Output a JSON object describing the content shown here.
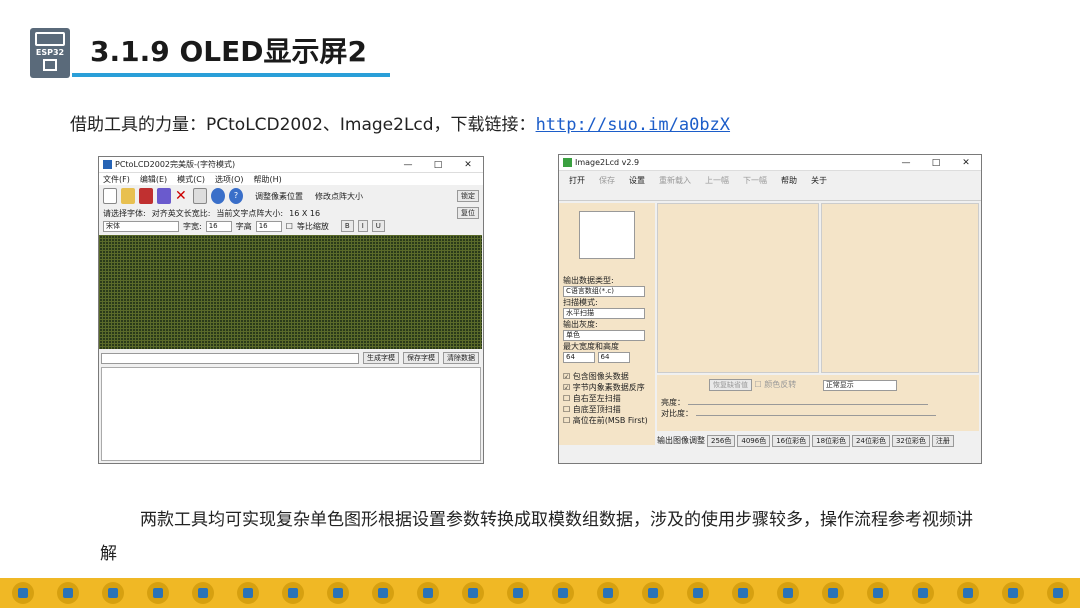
{
  "header": {
    "title": "3.1.9 OLED显示屏2",
    "logo_label": "ESP32"
  },
  "intro": {
    "text": "借助工具的力量：PCtoLCD2002、Image2Lcd，下载链接：",
    "link": "http://suo.im/a0bzX"
  },
  "pctolcd": {
    "title": "PCtoLCD2002完美版-(字符模式)",
    "menu": [
      "文件(F)",
      "编辑(E)",
      "模式(C)",
      "选项(O)",
      "帮助(H)"
    ],
    "labels": {
      "adjust": "调整像素位置",
      "modify": "修改点阵大小",
      "size_hint": "当前文字点阵大小:",
      "size_val": "16 X 16",
      "lock": "锁定",
      "reset": "复位",
      "choose_font": "请选择字体:",
      "align": "对齐英文长宽比:",
      "font_val": "宋体",
      "width_lbl": "字宽:",
      "width_val": "16",
      "height_lbl": "字高",
      "height_val": "16",
      "scale": "等比缩放"
    },
    "buttons": [
      "生成字模",
      "保存字模",
      "清除数据"
    ]
  },
  "image2lcd": {
    "title": "Image2Lcd v2.9",
    "toolbar": [
      "打开",
      "保存",
      "设置",
      "重新载入",
      "上一幅",
      "下一幅",
      "帮助",
      "关于"
    ],
    "fields": [
      {
        "label": "输出数据类型:",
        "value": "C语言数组(*.c)"
      },
      {
        "label": "扫描模式:",
        "value": "水平扫描"
      },
      {
        "label": "输出灰度:",
        "value": "单色"
      },
      {
        "label": "最大宽度和高度",
        "value": "64"
      }
    ],
    "height_val": "64",
    "checks": [
      {
        "label": "包含图像头数据",
        "checked": true
      },
      {
        "label": "字节内象素数据反序",
        "checked": true
      },
      {
        "label": "自右至左扫描",
        "checked": false
      },
      {
        "label": "自底至顶扫描",
        "checked": false
      },
      {
        "label": "高位在前(MSB First)",
        "checked": false
      }
    ],
    "restore": "恢复缺省值",
    "color_reverse": "颜色反转",
    "mode": "正常显示",
    "brightness": "亮度：",
    "contrast": "对比度：",
    "tabs": [
      "输出图像调整",
      "256色",
      "4096色",
      "16位彩色",
      "18位彩色",
      "24位彩色",
      "32位彩色",
      "注册"
    ]
  },
  "conclusion": "两款工具均可实现复杂单色图形根据设置参数转换成取模数组数据，涉及的使用步骤较多，操作流程参考视频讲解"
}
